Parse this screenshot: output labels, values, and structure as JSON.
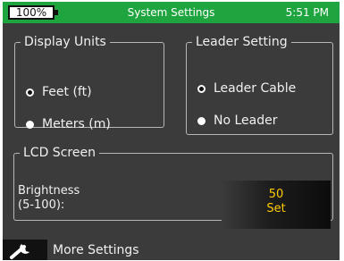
{
  "status_bar": {
    "battery": "100%",
    "title": "System Settings",
    "time": "5:51 PM"
  },
  "display_units": {
    "legend": "Display Units",
    "options": [
      {
        "label": "Feet (ft)",
        "selected": true
      },
      {
        "label": "Meters (m)",
        "selected": false
      }
    ]
  },
  "leader_setting": {
    "legend": "Leader Setting",
    "options": [
      {
        "label": "Leader Cable",
        "selected": true
      },
      {
        "label": "No Leader",
        "selected": false
      }
    ]
  },
  "lcd_screen": {
    "legend": "LCD Screen",
    "brightness_label": "Brightness",
    "brightness_range": "(5-100):",
    "brightness_value": "50",
    "set_label": "Set"
  },
  "footer": {
    "more_settings": "More Settings",
    "icon": "wrench-icon"
  },
  "colors": {
    "status_bar": "#1fa53f",
    "background": "#3b3b3b",
    "value_text": "#ffcc00"
  }
}
